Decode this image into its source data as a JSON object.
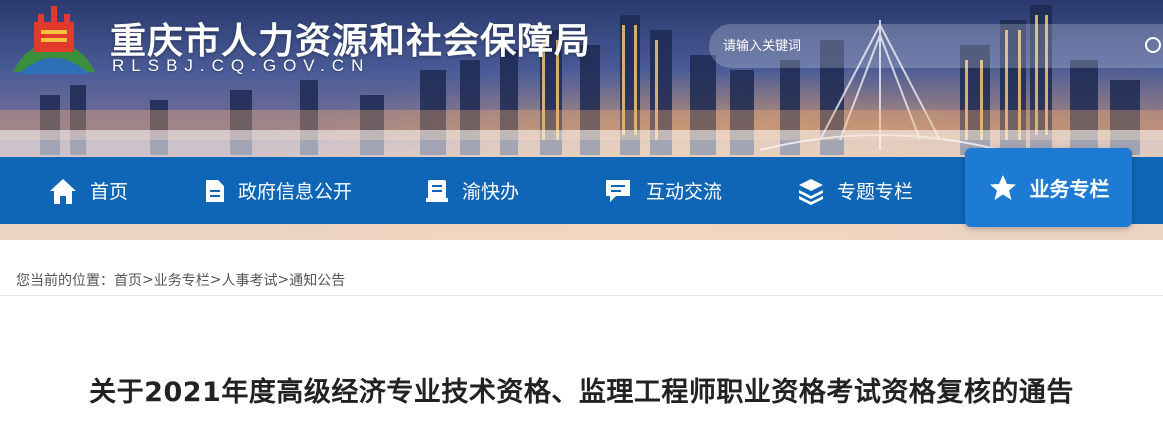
{
  "header": {
    "site_title": "重庆市人力资源和社会保障局",
    "site_domain": "RLSBJ.CQ.GOV.CN"
  },
  "search": {
    "placeholder": "请输入关键词"
  },
  "nav": {
    "items": [
      {
        "label": "首页",
        "icon": "home-icon"
      },
      {
        "label": "政府信息公开",
        "icon": "document-icon"
      },
      {
        "label": "渝快办",
        "icon": "book-icon"
      },
      {
        "label": "互动交流",
        "icon": "chat-icon"
      },
      {
        "label": "专题专栏",
        "icon": "layers-icon"
      },
      {
        "label": "业务专栏",
        "icon": "star-icon",
        "active": true
      }
    ]
  },
  "breadcrumb": {
    "prefix": "您当前的位置：",
    "items": [
      "首页",
      "业务专栏",
      "人事考试",
      "通知公告"
    ],
    "separator": ">"
  },
  "article": {
    "title": "关于2021年度高级经济专业技术资格、监理工程师职业资格考试资格复核的通告"
  },
  "colors": {
    "nav_bg": "#0f66b6",
    "nav_active_bg": "#1e7bd3",
    "title_text": "#222222"
  }
}
